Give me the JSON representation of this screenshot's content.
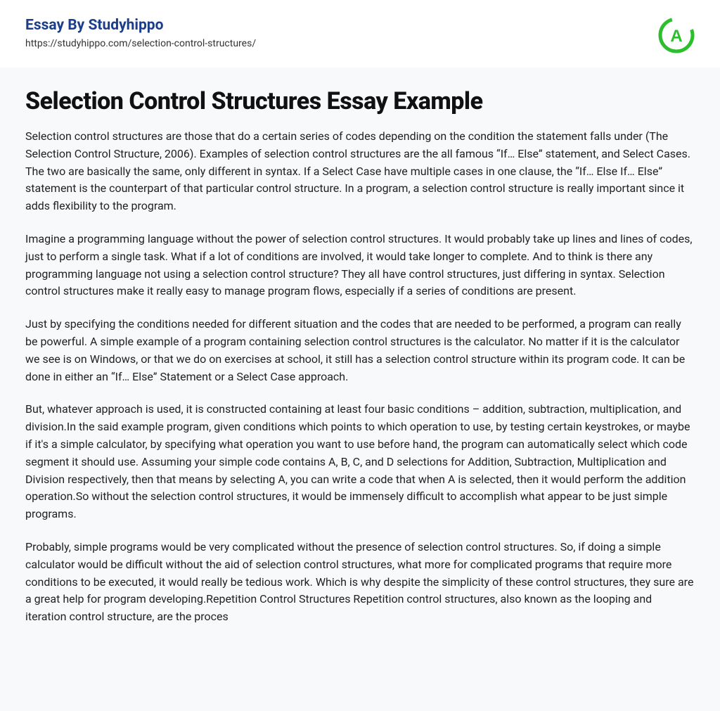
{
  "header": {
    "site_name": "Essay By Studyhippo",
    "url": "https://studyhippo.com/selection-control-structures/"
  },
  "logo": {
    "letter": "A",
    "color": "#2DBE2D"
  },
  "title": "Selection Control Structures Essay Example",
  "paragraphs": [
    "Selection control structures are those that do a certain series of codes depending on the condition the statement falls under (The Selection Control Structure, 2006). Examples of selection control structures are the all famous “If… Else” statement, and Select Cases. The two are basically the same, only different in syntax. If a Select Case have multiple cases in one clause, the “If… Else If… Else” statement is the counterpart of that particular control structure. In a program, a selection control structure is really important since it adds flexibility to the program.",
    "Imagine a programming language without the power of selection control structures. It would probably take up lines and lines of codes, just to perform a single task. What if a lot of conditions are involved, it would take longer to complete. And to think is there any programming language not using a selection control structure? They all have control structures, just differing in syntax. Selection control structures make it really easy to manage program flows, especially if a series of conditions are present.",
    "Just by specifying the conditions needed for different situation and the codes that are needed to be performed, a program can really be powerful. A simple example of a program containing selection control structures is the calculator. No matter if it is the calculator we see is on Windows, or that we do on exercises at school, it still has a selection control structure within its program code. It can be done in either an “If… Else” Statement or a Select Case approach.",
    "But, whatever approach is used, it is constructed containing at least four basic conditions – addition, subtraction, multiplication, and division.In the said example program, given conditions which points to which operation to use, by testing certain keystrokes, or maybe if it's a simple calculator, by specifying what operation you want to use before hand, the program can automatically select which code segment it should use. Assuming your simple code contains A, B, C, and D selections for Addition, Subtraction, Multiplication and Division respectively, then that means by selecting A, you can write a code that when A is selected, then it would perform the addition operation.So without the selection control structures, it would be immensely difficult to accomplish what appear to be just simple programs.",
    "Probably, simple programs would be very complicated without the presence of selection control structures. So, if doing a simple calculator would be difficult without the aid of selection control structures, what more for complicated programs that require more conditions to be executed, it would really be tedious work. Which is why despite the simplicity of these control structures, they sure are a great help for program developing.Repetition Control Structures Repetition control structures, also known as the looping and iteration control structure, are the proces"
  ]
}
